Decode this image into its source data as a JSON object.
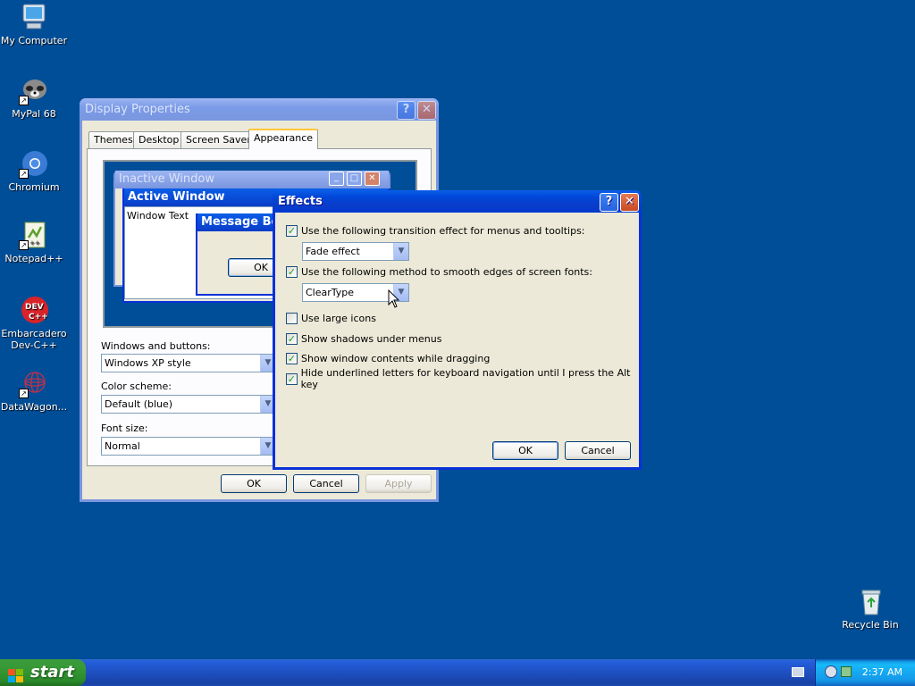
{
  "desktop": {
    "icons": [
      {
        "label": "My Computer"
      },
      {
        "label": "MyPal 68"
      },
      {
        "label": "Chromium"
      },
      {
        "label": "Notepad++"
      },
      {
        "label": "Embarcadero Dev-C++"
      },
      {
        "label": "DataWagon..."
      },
      {
        "label": "Recycle Bin"
      }
    ]
  },
  "display_properties": {
    "title": "Display Properties",
    "tabs": [
      "Themes",
      "Desktop",
      "Screen Saver",
      "Appearance"
    ],
    "active_tab": "Appearance",
    "preview": {
      "inactive_title": "Inactive Window",
      "active_title": "Active Window",
      "window_text": "Window Text",
      "message_box_title": "Message Box",
      "message_box_ok": "OK"
    },
    "windows_buttons_label": "Windows and buttons:",
    "windows_buttons_value": "Windows XP style",
    "color_scheme_label": "Color scheme:",
    "color_scheme_value": "Default (blue)",
    "font_size_label": "Font size:",
    "font_size_value": "Normal",
    "ok": "OK",
    "cancel": "Cancel",
    "apply": "Apply"
  },
  "effects": {
    "title": "Effects",
    "options": [
      {
        "label": "Use the following transition effect for menus and tooltips:",
        "checked": true
      },
      {
        "label": "Use the following method to smooth edges of screen fonts:",
        "checked": true
      },
      {
        "label": "Use large icons",
        "checked": false
      },
      {
        "label": "Show shadows under menus",
        "checked": true
      },
      {
        "label": "Show window contents while dragging",
        "checked": true
      },
      {
        "label": "Hide underlined letters for keyboard navigation until I press the Alt key",
        "checked": true
      }
    ],
    "transition_value": "Fade effect",
    "smoothing_value": "ClearType",
    "ok": "OK",
    "cancel": "Cancel"
  },
  "taskbar": {
    "start": "start",
    "clock": "2:37 AM"
  },
  "colors": {
    "desktop": "#004e98",
    "title_active": "#0a3cc8",
    "dialog_face": "#ece9d8"
  }
}
